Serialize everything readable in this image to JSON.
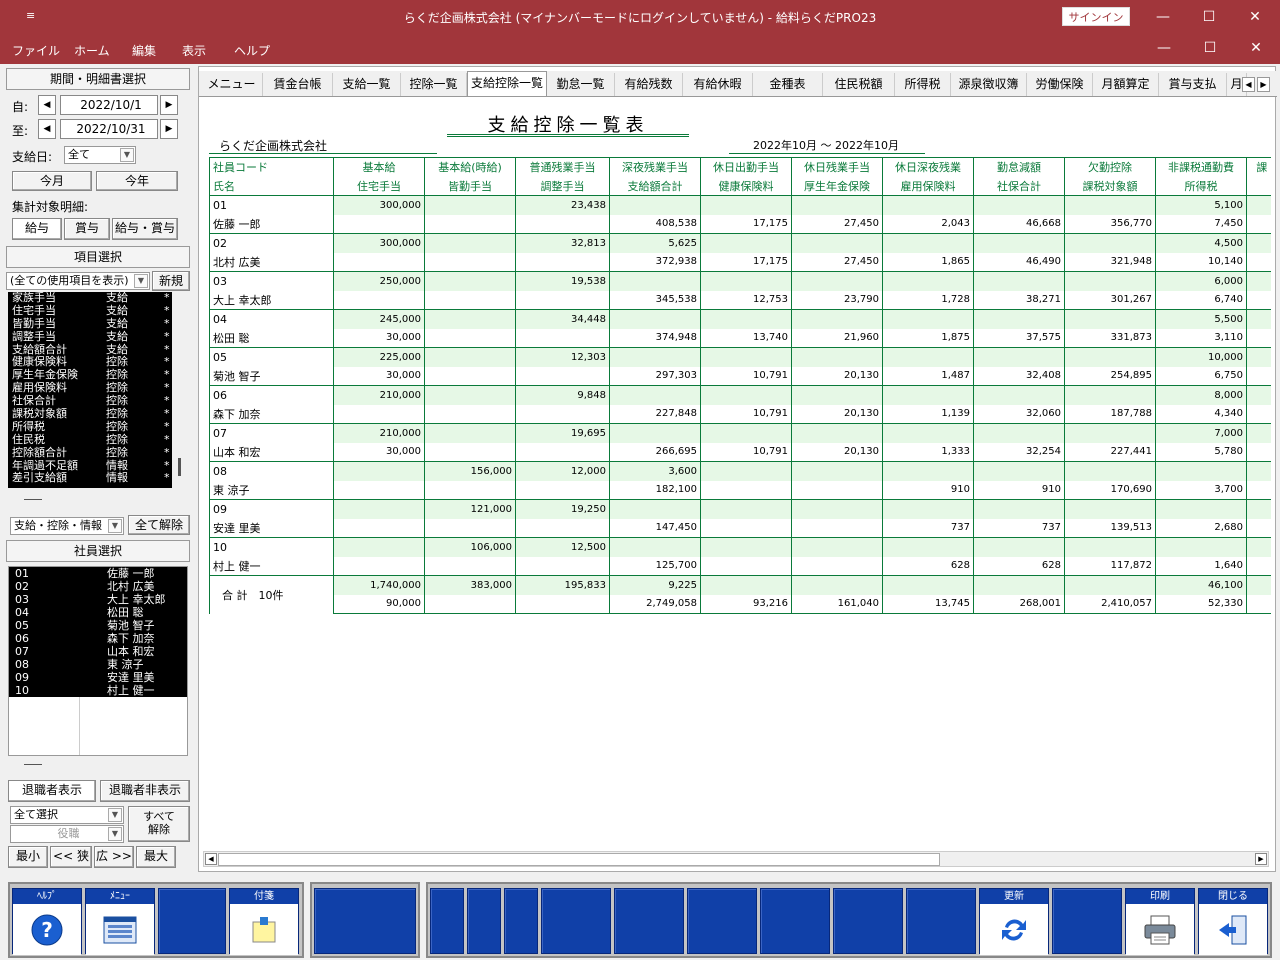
{
  "window": {
    "title": "らくだ企画株式会社 (マイナンバーモードにログインしていません) - 給料らくだPRO23",
    "signin": "サインイン",
    "sysmenu": "≡",
    "min": "—",
    "max": "☐",
    "close": "✕"
  },
  "menu": {
    "items": [
      "ファイル",
      "ホーム",
      "編集",
      "表示",
      "ヘルプ"
    ]
  },
  "left": {
    "period_header": "期間・明細書選択",
    "from_label": "自:",
    "from_value": "2022/10/1",
    "to_label": "至:",
    "to_value": "2022/10/31",
    "payday_label": "支給日:",
    "payday_value": "全て",
    "this_month": "今月",
    "this_year": "今年",
    "target_label": "集計対象明細:",
    "target_options": [
      "給与",
      "賞与",
      "給与・賞与"
    ],
    "item_header": "項目選択",
    "item_filter": "(全ての使用項目を表示)",
    "new_button": "新規",
    "items": [
      [
        "家族手当",
        "支給",
        "*"
      ],
      [
        "住宅手当",
        "支給",
        "*"
      ],
      [
        "皆勤手当",
        "支給",
        "*"
      ],
      [
        "調整手当",
        "支給",
        "*"
      ],
      [
        "支給額合計",
        "支給",
        "*"
      ],
      [
        "健康保険料",
        "控除",
        "*"
      ],
      [
        "厚生年金保険",
        "控除",
        "*"
      ],
      [
        "雇用保険料",
        "控除",
        "*"
      ],
      [
        "社保合計",
        "控除",
        "*"
      ],
      [
        "課税対象額",
        "控除",
        "*"
      ],
      [
        "所得税",
        "控除",
        "*"
      ],
      [
        "住民税",
        "控除",
        "*"
      ],
      [
        "控除額合計",
        "控除",
        "*"
      ],
      [
        "年調過不足額",
        "情報",
        "*"
      ],
      [
        "差引支給額",
        "情報",
        "*"
      ]
    ],
    "item_type_filter": "支給・控除・情報",
    "clear_all": "全て解除",
    "emp_header": "社員選択",
    "employees": [
      [
        "01",
        "佐藤 一郎"
      ],
      [
        "02",
        "北村 広美"
      ],
      [
        "03",
        "大上 幸太郎"
      ],
      [
        "04",
        "松田 聡"
      ],
      [
        "05",
        "菊池 智子"
      ],
      [
        "06",
        "森下 加奈"
      ],
      [
        "07",
        "山本 和宏"
      ],
      [
        "08",
        "東 涼子"
      ],
      [
        "09",
        "安達 里美"
      ],
      [
        "10",
        "村上 健一"
      ]
    ],
    "retired_show": "退職者表示",
    "retired_hide": "退職者非表示",
    "select_all": "全て選択",
    "position": "役職",
    "clear_all2": "すべて\n解除",
    "size_buttons": [
      "最小",
      "<< 狭",
      "広 >>",
      "最大"
    ]
  },
  "tabs": [
    "メニュー",
    "賃金台帳",
    "支給一覧",
    "控除一覧",
    "支給控除一覧",
    "勤怠一覧",
    "有給残数",
    "有給休暇",
    "金種表",
    "住民税額",
    "所得税",
    "源泉徴収簿",
    "労働保険",
    "月額算定",
    "賞与支払",
    "月"
  ],
  "report": {
    "title": "支給控除一覧表",
    "company": "らくだ企画株式会社",
    "period": "2022年10月 〜 2022年10月",
    "header_top": [
      "社員コード",
      "基本給",
      "基本給(時給)",
      "普通残業手当",
      "深夜残業手当",
      "休日出勤手当",
      "休日残業手当",
      "休日深夜残業",
      "勤怠減額",
      "欠勤控除",
      "非課税通勤費",
      "課"
    ],
    "header_bottom": [
      "氏名",
      "住宅手当",
      "皆勤手当",
      "調整手当",
      "支給額合計",
      "健康保険料",
      "厚生年金保険",
      "雇用保険料",
      "社保合計",
      "課税対象額",
      "所得税",
      ""
    ],
    "rows": [
      {
        "code": "01",
        "name": "佐藤 一郎",
        "top": [
          "300,000",
          "",
          "23,438",
          "",
          "",
          "",
          "",
          "",
          "",
          "5,100",
          ""
        ],
        "bottom": [
          "",
          "",
          "",
          "408,538",
          "17,175",
          "27,450",
          "2,043",
          "46,668",
          "356,770",
          "7,450",
          ""
        ]
      },
      {
        "code": "02",
        "name": "北村 広美",
        "top": [
          "300,000",
          "",
          "32,813",
          "5,625",
          "",
          "",
          "",
          "",
          "",
          "4,500",
          ""
        ],
        "bottom": [
          "",
          "",
          "",
          "372,938",
          "17,175",
          "27,450",
          "1,865",
          "46,490",
          "321,948",
          "10,140",
          ""
        ]
      },
      {
        "code": "03",
        "name": "大上 幸太郎",
        "top": [
          "250,000",
          "",
          "19,538",
          "",
          "",
          "",
          "",
          "",
          "",
          "6,000",
          ""
        ],
        "bottom": [
          "",
          "",
          "",
          "345,538",
          "12,753",
          "23,790",
          "1,728",
          "38,271",
          "301,267",
          "6,740",
          ""
        ]
      },
      {
        "code": "04",
        "name": "松田 聡",
        "top": [
          "245,000",
          "",
          "34,448",
          "",
          "",
          "",
          "",
          "",
          "",
          "5,500",
          ""
        ],
        "bottom": [
          "30,000",
          "",
          "",
          "374,948",
          "13,740",
          "21,960",
          "1,875",
          "37,575",
          "331,873",
          "3,110",
          ""
        ]
      },
      {
        "code": "05",
        "name": "菊池 智子",
        "top": [
          "225,000",
          "",
          "12,303",
          "",
          "",
          "",
          "",
          "",
          "",
          "10,000",
          ""
        ],
        "bottom": [
          "30,000",
          "",
          "",
          "297,303",
          "10,791",
          "20,130",
          "1,487",
          "32,408",
          "254,895",
          "6,750",
          ""
        ]
      },
      {
        "code": "06",
        "name": "森下 加奈",
        "top": [
          "210,000",
          "",
          "9,848",
          "",
          "",
          "",
          "",
          "",
          "",
          "8,000",
          ""
        ],
        "bottom": [
          "",
          "",
          "",
          "227,848",
          "10,791",
          "20,130",
          "1,139",
          "32,060",
          "187,788",
          "4,340",
          ""
        ]
      },
      {
        "code": "07",
        "name": "山本 和宏",
        "top": [
          "210,000",
          "",
          "19,695",
          "",
          "",
          "",
          "",
          "",
          "",
          "7,000",
          ""
        ],
        "bottom": [
          "30,000",
          "",
          "",
          "266,695",
          "10,791",
          "20,130",
          "1,333",
          "32,254",
          "227,441",
          "5,780",
          ""
        ]
      },
      {
        "code": "08",
        "name": "東 涼子",
        "top": [
          "",
          "156,000",
          "12,000",
          "3,600",
          "",
          "",
          "",
          "",
          "",
          "",
          ""
        ],
        "bottom": [
          "",
          "",
          "",
          "182,100",
          "",
          "",
          "910",
          "910",
          "170,690",
          "3,700",
          ""
        ]
      },
      {
        "code": "09",
        "name": "安達 里美",
        "top": [
          "",
          "121,000",
          "19,250",
          "",
          "",
          "",
          "",
          "",
          "",
          "",
          ""
        ],
        "bottom": [
          "",
          "",
          "",
          "147,450",
          "",
          "",
          "737",
          "737",
          "139,513",
          "2,680",
          ""
        ]
      },
      {
        "code": "10",
        "name": "村上 健一",
        "top": [
          "",
          "106,000",
          "12,500",
          "",
          "",
          "",
          "",
          "",
          "",
          "",
          ""
        ],
        "bottom": [
          "",
          "",
          "",
          "125,700",
          "",
          "",
          "628",
          "628",
          "117,872",
          "1,640",
          ""
        ]
      }
    ],
    "total": {
      "label": "合 計　10件",
      "top": [
        "1,740,000",
        "383,000",
        "195,833",
        "9,225",
        "",
        "",
        "",
        "",
        "",
        "46,100",
        ""
      ],
      "bottom": [
        "90,000",
        "",
        "",
        "2,749,058",
        "93,216",
        "161,040",
        "13,745",
        "268,001",
        "2,410,057",
        "52,330",
        ""
      ]
    }
  },
  "fkeys": {
    "help": "ﾍﾙﾌﾟ",
    "menu": "ﾒﾆｭｰ",
    "note": "付箋",
    "update": "更新",
    "print": "印刷",
    "close": "閉じる"
  }
}
